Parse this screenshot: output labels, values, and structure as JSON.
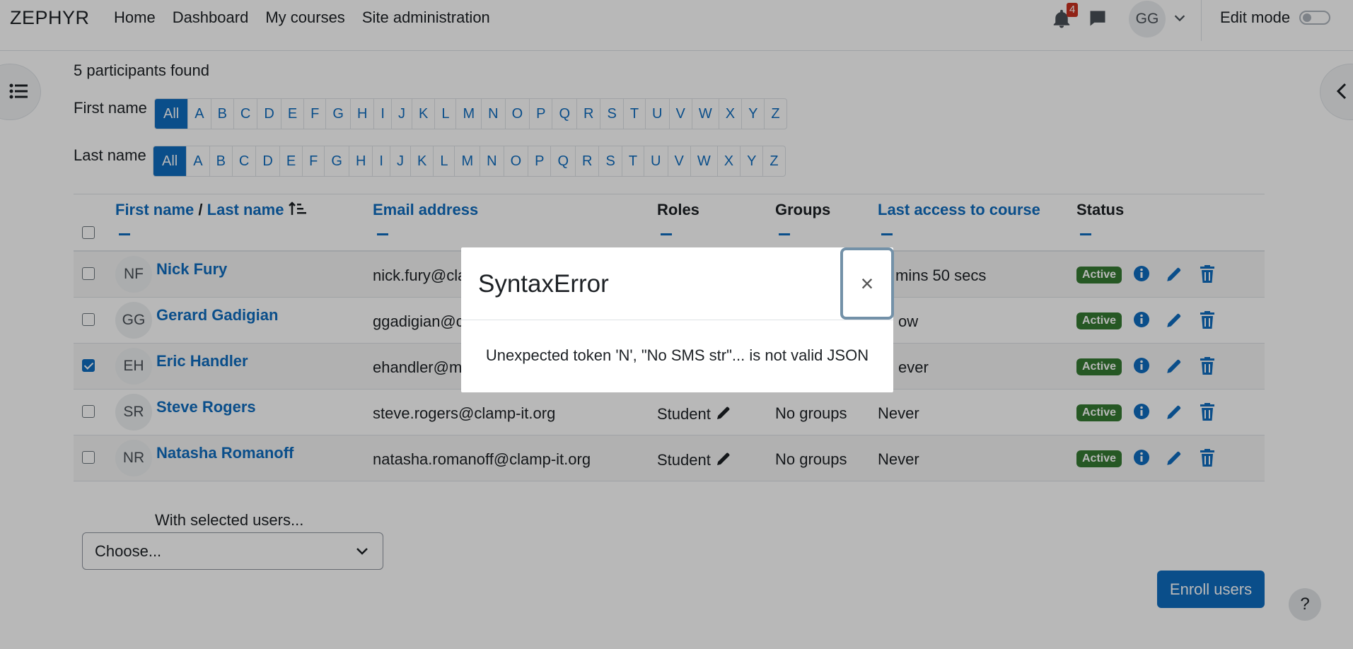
{
  "navbar": {
    "brand": "ZEPHYR",
    "links": [
      "Home",
      "Dashboard",
      "My courses",
      "Site administration"
    ],
    "notification_count": "4",
    "user_initials": "GG",
    "edit_mode_label": "Edit mode",
    "edit_mode_on": false
  },
  "participants": {
    "found_text": "5 participants found",
    "first_name_label": "First name",
    "last_name_label": "Last name",
    "letters": [
      "All",
      "A",
      "B",
      "C",
      "D",
      "E",
      "F",
      "G",
      "H",
      "I",
      "J",
      "K",
      "L",
      "M",
      "N",
      "O",
      "P",
      "Q",
      "R",
      "S",
      "T",
      "U",
      "V",
      "W",
      "X",
      "Y",
      "Z"
    ],
    "selected_letter": "All"
  },
  "table": {
    "headers": {
      "first_name": "First name",
      "separator": "/",
      "last_name": "Last name",
      "email": "Email address",
      "roles": "Roles",
      "groups": "Groups",
      "last_access": "Last access to course",
      "status": "Status"
    },
    "rows": [
      {
        "initials": "NF",
        "name": "Nick Fury",
        "email": "nick.fury@cla",
        "role": "",
        "groups": "",
        "last_access": "mins 50 secs",
        "status": "Active",
        "checked": false
      },
      {
        "initials": "GG",
        "name": "Gerard Gadigian",
        "email": "ggadigian@c",
        "role": "",
        "groups": "",
        "last_access": "ow",
        "status": "Active",
        "checked": false
      },
      {
        "initials": "EH",
        "name": "Eric Handler",
        "email": "ehandler@m",
        "role": "",
        "groups": "",
        "last_access": "ever",
        "status": "Active",
        "checked": true
      },
      {
        "initials": "SR",
        "name": "Steve Rogers",
        "email": "steve.rogers@clamp-it.org",
        "role": "Student",
        "groups": "No groups",
        "last_access": "Never",
        "status": "Active",
        "checked": false
      },
      {
        "initials": "NR",
        "name": "Natasha Romanoff",
        "email": "natasha.romanoff@clamp-it.org",
        "role": "Student",
        "groups": "No groups",
        "last_access": "Never",
        "status": "Active",
        "checked": false
      }
    ]
  },
  "bulk": {
    "label": "With selected users...",
    "select_value": "Choose..."
  },
  "enroll_label": "Enroll users",
  "help_label": "?",
  "modal": {
    "title": "SyntaxError",
    "close": "×",
    "message": "Unexpected token 'N', \"No SMS str\"... is not valid JSON"
  },
  "colors": {
    "link": "#0f6cbf",
    "active_badge": "#357a32",
    "notification_badge": "#ca3120",
    "close_button_border": "#7391a8"
  },
  "icons": [
    "bell-icon",
    "chat-icon",
    "chevron-down-icon",
    "list-icon",
    "chevron-left-icon",
    "sort-ascending-icon",
    "info-icon",
    "pencil-icon",
    "trash-icon",
    "close-icon",
    "question-icon"
  ]
}
